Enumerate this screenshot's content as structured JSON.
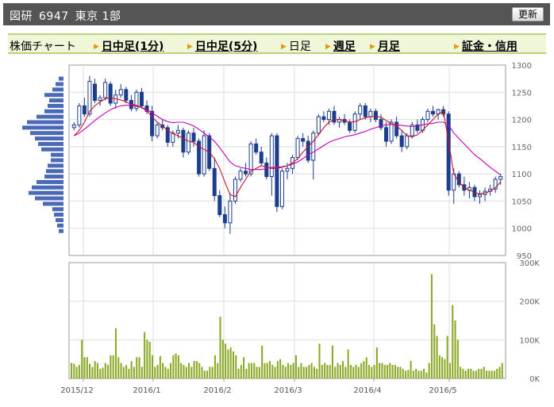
{
  "header": {
    "title_parts": [
      "図研",
      "6947",
      "東京 1部"
    ],
    "refresh_label": "更新"
  },
  "tabs": {
    "label": "株価チャート",
    "items": [
      {
        "label": "日中足(1分)",
        "link": true
      },
      {
        "label": "日中足(5分)",
        "link": true
      },
      {
        "label": "日足",
        "link": false
      },
      {
        "label": "週足",
        "link": true
      },
      {
        "label": "月足",
        "link": true
      },
      {
        "label": "証金・信用",
        "link": true
      }
    ]
  },
  "colors": {
    "candle": "#1c3c8c",
    "ma_short": "#c8142a",
    "ma_long": "#c000c0",
    "volume": "#8aaa28",
    "profile": "#4a6ab8",
    "tab_arrow": "#e09a18"
  },
  "chart_data": {
    "type": "candlestick",
    "price_axis": {
      "ylim": [
        950,
        1300
      ],
      "ticks": [
        950,
        1000,
        1050,
        1100,
        1150,
        1200,
        1250,
        1300
      ]
    },
    "volume_axis": {
      "ylim": [
        0,
        300000
      ],
      "tick_labels": [
        "0K",
        "100K",
        "200K",
        "300K"
      ]
    },
    "x_labels": [
      "2015/12",
      "2016/1",
      "2016/2",
      "2016/3",
      "2016/4",
      "2016/5"
    ],
    "candles_ohlc": [
      [
        1185,
        1195,
        1180,
        1190
      ],
      [
        1190,
        1230,
        1185,
        1225
      ],
      [
        1225,
        1240,
        1205,
        1210
      ],
      [
        1210,
        1280,
        1205,
        1270
      ],
      [
        1265,
        1275,
        1230,
        1235
      ],
      [
        1235,
        1245,
        1225,
        1240
      ],
      [
        1240,
        1275,
        1235,
        1268
      ],
      [
        1265,
        1270,
        1225,
        1230
      ],
      [
        1230,
        1255,
        1220,
        1245
      ],
      [
        1245,
        1265,
        1240,
        1255
      ],
      [
        1255,
        1260,
        1230,
        1235
      ],
      [
        1235,
        1245,
        1215,
        1220
      ],
      [
        1220,
        1255,
        1215,
        1250
      ],
      [
        1250,
        1258,
        1220,
        1225
      ],
      [
        1225,
        1235,
        1210,
        1215
      ],
      [
        1215,
        1225,
        1160,
        1170
      ],
      [
        1170,
        1195,
        1165,
        1190
      ],
      [
        1190,
        1200,
        1180,
        1185
      ],
      [
        1185,
        1190,
        1150,
        1158
      ],
      [
        1158,
        1180,
        1150,
        1175
      ],
      [
        1175,
        1190,
        1165,
        1180
      ],
      [
        1180,
        1185,
        1130,
        1140
      ],
      [
        1140,
        1180,
        1135,
        1175
      ],
      [
        1175,
        1185,
        1150,
        1160
      ],
      [
        1160,
        1165,
        1095,
        1100
      ],
      [
        1100,
        1180,
        1095,
        1170
      ],
      [
        1170,
        1175,
        1105,
        1110
      ],
      [
        1110,
        1130,
        1050,
        1060
      ],
      [
        1060,
        1070,
        1020,
        1025
      ],
      [
        1025,
        1040,
        1000,
        1010
      ],
      [
        1010,
        1065,
        990,
        1050
      ],
      [
        1050,
        1095,
        1045,
        1090
      ],
      [
        1090,
        1110,
        1085,
        1105
      ],
      [
        1105,
        1120,
        1095,
        1100
      ],
      [
        1100,
        1160,
        1095,
        1155
      ],
      [
        1155,
        1165,
        1135,
        1140
      ],
      [
        1140,
        1150,
        1115,
        1120
      ],
      [
        1120,
        1130,
        1090,
        1095
      ],
      [
        1095,
        1175,
        1060,
        1170
      ],
      [
        1170,
        1175,
        1030,
        1040
      ],
      [
        1040,
        1110,
        1035,
        1105
      ],
      [
        1105,
        1120,
        1090,
        1110
      ],
      [
        1110,
        1135,
        1100,
        1130
      ],
      [
        1130,
        1170,
        1125,
        1165
      ],
      [
        1165,
        1175,
        1150,
        1160
      ],
      [
        1160,
        1170,
        1120,
        1125
      ],
      [
        1125,
        1180,
        1090,
        1175
      ],
      [
        1175,
        1210,
        1170,
        1205
      ],
      [
        1205,
        1215,
        1195,
        1200
      ],
      [
        1200,
        1220,
        1190,
        1215
      ],
      [
        1215,
        1225,
        1190,
        1195
      ],
      [
        1195,
        1205,
        1185,
        1200
      ],
      [
        1200,
        1210,
        1190,
        1195
      ],
      [
        1195,
        1200,
        1175,
        1180
      ],
      [
        1180,
        1215,
        1175,
        1210
      ],
      [
        1210,
        1230,
        1200,
        1225
      ],
      [
        1225,
        1230,
        1200,
        1205
      ],
      [
        1205,
        1220,
        1195,
        1215
      ],
      [
        1215,
        1220,
        1195,
        1200
      ],
      [
        1200,
        1210,
        1180,
        1185
      ],
      [
        1185,
        1195,
        1150,
        1160
      ],
      [
        1160,
        1200,
        1155,
        1195
      ],
      [
        1195,
        1205,
        1165,
        1170
      ],
      [
        1170,
        1180,
        1140,
        1150
      ],
      [
        1150,
        1175,
        1145,
        1170
      ],
      [
        1170,
        1195,
        1165,
        1190
      ],
      [
        1190,
        1200,
        1175,
        1180
      ],
      [
        1180,
        1205,
        1175,
        1200
      ],
      [
        1200,
        1220,
        1195,
        1215
      ],
      [
        1215,
        1225,
        1205,
        1210
      ],
      [
        1210,
        1220,
        1200,
        1218
      ],
      [
        1218,
        1225,
        1205,
        1210
      ],
      [
        1210,
        1215,
        1060,
        1070
      ],
      [
        1070,
        1110,
        1045,
        1100
      ],
      [
        1100,
        1105,
        1075,
        1080
      ],
      [
        1080,
        1095,
        1060,
        1070
      ],
      [
        1070,
        1085,
        1055,
        1075
      ],
      [
        1075,
        1080,
        1050,
        1058
      ],
      [
        1058,
        1070,
        1045,
        1062
      ],
      [
        1062,
        1075,
        1050,
        1068
      ],
      [
        1068,
        1080,
        1060,
        1072
      ],
      [
        1072,
        1095,
        1065,
        1090
      ],
      [
        1090,
        1100,
        1080,
        1095
      ]
    ],
    "ma_short": [
      1170,
      1180,
      1195,
      1215,
      1225,
      1232,
      1238,
      1240,
      1238,
      1236,
      1232,
      1228,
      1226,
      1222,
      1216,
      1205,
      1195,
      1188,
      1180,
      1174,
      1170,
      1165,
      1160,
      1158,
      1150,
      1145,
      1140,
      1128,
      1110,
      1085,
      1062,
      1058,
      1075,
      1090,
      1105,
      1110,
      1115,
      1112,
      1110,
      1110,
      1112,
      1115,
      1120,
      1128,
      1140,
      1150,
      1160,
      1172,
      1185,
      1195,
      1200,
      1200,
      1198,
      1195,
      1196,
      1200,
      1203,
      1205,
      1206,
      1204,
      1198,
      1192,
      1188,
      1180,
      1170,
      1168,
      1172,
      1180,
      1190,
      1200,
      1210,
      1215,
      1160,
      1100,
      1085,
      1075,
      1070,
      1066,
      1063,
      1065,
      1068,
      1075,
      1085
    ],
    "ma_long": [
      1170,
      1175,
      1182,
      1190,
      1198,
      1205,
      1212,
      1218,
      1222,
      1225,
      1226,
      1226,
      1224,
      1222,
      1218,
      1212,
      1206,
      1200,
      1196,
      1194,
      1195,
      1195,
      1192,
      1188,
      1182,
      1175,
      1168,
      1160,
      1148,
      1135,
      1122,
      1115,
      1112,
      1110,
      1108,
      1108,
      1108,
      1110,
      1112,
      1112,
      1113,
      1115,
      1118,
      1122,
      1128,
      1135,
      1140,
      1146,
      1152,
      1158,
      1162,
      1165,
      1168,
      1170,
      1172,
      1175,
      1178,
      1182,
      1185,
      1188,
      1190,
      1191,
      1190,
      1189,
      1188,
      1187,
      1188,
      1190,
      1192,
      1193,
      1195,
      1195,
      1190,
      1175,
      1165,
      1155,
      1145,
      1135,
      1128,
      1120,
      1112,
      1105,
      1098
    ],
    "volume": [
      40000,
      38000,
      30000,
      35000,
      100000,
      55000,
      55000,
      38000,
      30000,
      45000,
      40000,
      25000,
      28000,
      40000,
      35000,
      60000,
      60000,
      130000,
      55000,
      40000,
      30000,
      35000,
      25000,
      45000,
      30000,
      55000,
      55000,
      30000,
      120000,
      100000,
      95000,
      60000,
      30000,
      35000,
      58000,
      40000,
      30000,
      25000,
      40000,
      60000,
      65000,
      60000,
      40000,
      35000,
      30000,
      40000,
      30000,
      45000,
      45000,
      40000,
      30000,
      20000,
      20000,
      30000,
      30000,
      60000,
      40000,
      160000,
      100000,
      90000,
      75000,
      80000,
      70000,
      60000,
      25000,
      35000,
      55000,
      25000,
      40000,
      40000,
      40000,
      30000,
      30000,
      85000,
      40000,
      40000,
      45000,
      35000,
      30000,
      45000,
      50000,
      35000,
      30000,
      40000,
      35000,
      40000,
      60000,
      30000,
      40000,
      30000,
      30000,
      35000,
      40000,
      30000,
      25000,
      90000,
      35000,
      40000,
      35000,
      35000,
      85000,
      30000,
      40000,
      35000,
      45000,
      30000,
      75000,
      35000,
      30000,
      35000,
      30000,
      40000,
      45000,
      55000,
      35000,
      30000,
      35000,
      80000,
      40000,
      40000,
      35000,
      35000,
      40000,
      35000,
      35000,
      30000,
      30000,
      25000,
      20000,
      22000,
      45000,
      20000,
      25000,
      20000,
      20000,
      25000,
      15000,
      40000,
      270000,
      140000,
      110000,
      60000,
      55000,
      50000,
      110000,
      40000,
      190000,
      150000,
      100000,
      30000,
      25000,
      20000,
      25000,
      25000,
      20000,
      20000,
      25000,
      25000,
      30000,
      20000,
      20000,
      20000,
      20000,
      25000,
      30000,
      40000
    ],
    "price_profile": [
      [
        1275,
        6
      ],
      [
        1265,
        10
      ],
      [
        1255,
        14
      ],
      [
        1245,
        24
      ],
      [
        1235,
        18
      ],
      [
        1225,
        20
      ],
      [
        1215,
        24
      ],
      [
        1205,
        34
      ],
      [
        1195,
        46
      ],
      [
        1185,
        52
      ],
      [
        1175,
        42
      ],
      [
        1165,
        36
      ],
      [
        1155,
        32
      ],
      [
        1145,
        28
      ],
      [
        1135,
        16
      ],
      [
        1125,
        16
      ],
      [
        1115,
        20
      ],
      [
        1105,
        22
      ],
      [
        1095,
        24
      ],
      [
        1085,
        34
      ],
      [
        1075,
        40
      ],
      [
        1065,
        44
      ],
      [
        1055,
        36
      ],
      [
        1045,
        26
      ],
      [
        1035,
        14
      ],
      [
        1025,
        12
      ],
      [
        1015,
        10
      ],
      [
        1005,
        8
      ],
      [
        995,
        6
      ]
    ]
  }
}
